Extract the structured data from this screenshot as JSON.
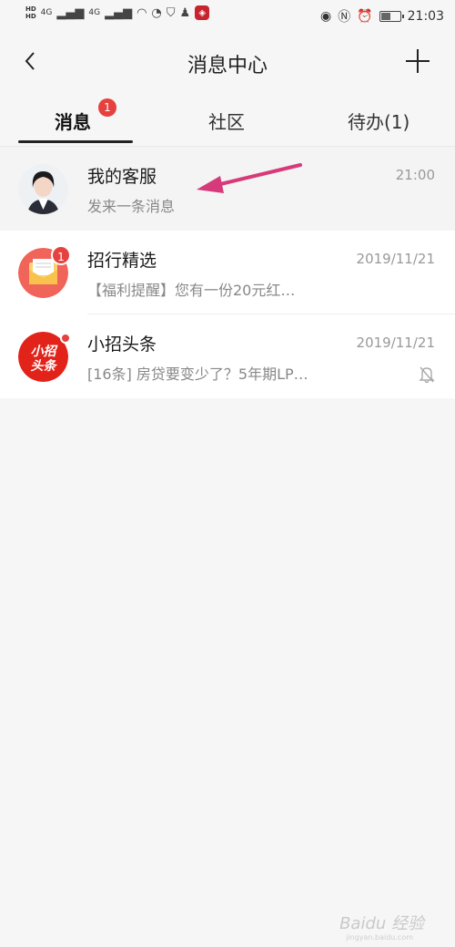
{
  "status_bar": {
    "network": "4G",
    "network2": "4G",
    "time": "21:03",
    "battery_level": 0.55
  },
  "nav": {
    "title": "消息中心",
    "back_icon": "back-chevron-icon",
    "add_icon": "plus-icon"
  },
  "tabs": [
    {
      "label": "消息",
      "badge": "1",
      "active": true
    },
    {
      "label": "社区"
    },
    {
      "label": "待办(1)"
    }
  ],
  "messages": [
    {
      "title": "我的客服",
      "preview": "发来一条消息",
      "time": "21:00",
      "avatar": "customer-service-avatar"
    },
    {
      "title": "招行精选",
      "preview": "【福利提醒】您有一份20元红…",
      "time": "2019/11/21",
      "badge": "1",
      "avatar": "envelope-icon"
    },
    {
      "title": "小招头条",
      "preview": "[16条] 房贷要变少了？5年期LP…",
      "time": "2019/11/21",
      "avatar_text": "小招\n头条",
      "muted": true
    }
  ],
  "annotation": {
    "color": "#d63a7a"
  },
  "watermark": {
    "text": "Baidu 经验",
    "sub": "jingyan.baidu.com"
  },
  "colors": {
    "accent_red": "#e5413f",
    "background": "#f6f6f6"
  }
}
